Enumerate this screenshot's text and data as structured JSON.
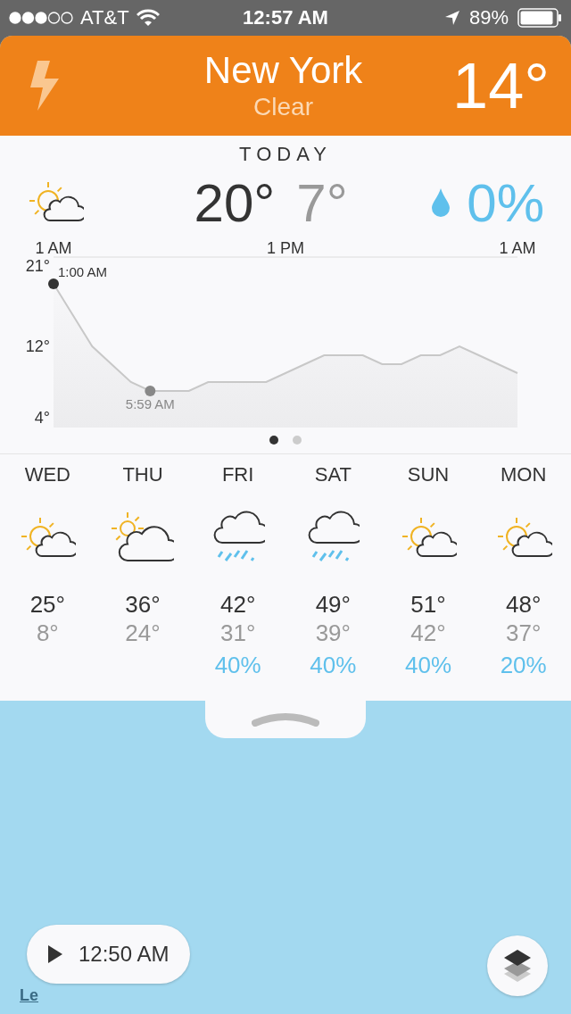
{
  "status_bar": {
    "carrier": "AT&T",
    "time": "12:57 AM",
    "battery": "89%"
  },
  "header": {
    "city": "New York",
    "condition": "Clear",
    "temperature": "14°"
  },
  "today": {
    "title": "TODAY",
    "kind": "partly-sunny",
    "high": "20°",
    "low": "7°",
    "precipitation": "0%",
    "chart_data": {
      "type": "area",
      "categories": [
        "1 AM",
        null,
        null,
        null,
        null,
        null,
        null,
        null,
        null,
        null,
        null,
        null,
        "1 PM",
        null,
        null,
        null,
        null,
        null,
        null,
        null,
        null,
        null,
        null,
        null,
        "1 AM"
      ],
      "series": [
        {
          "color": "#c8c8c8",
          "values": [
            19,
            15.5,
            12,
            10,
            8,
            7,
            7,
            7,
            8,
            8,
            8,
            8,
            9,
            10,
            11,
            11,
            11,
            10,
            10,
            11,
            11,
            12,
            11,
            10,
            9
          ]
        }
      ],
      "yticks": [
        {
          "value": 21,
          "label": "21°"
        },
        {
          "value": 12,
          "label": "12°"
        },
        {
          "value": 4,
          "label": "4°"
        }
      ],
      "ylim": [
        4,
        21
      ],
      "annotations": [
        "1:00 AM",
        "5:59 AM"
      ]
    }
  },
  "pages": [
    {
      "selected": true
    },
    {
      "selected": false
    }
  ],
  "forecast": [
    {
      "day": "WED",
      "kind": "partly-sunny",
      "high": "25°",
      "low": "8°"
    },
    {
      "day": "THU",
      "kind": "mostly-cloudy",
      "high": "36°",
      "low": "24°"
    },
    {
      "day": "FRI",
      "kind": "rain",
      "high": "42°",
      "low": "31°",
      "precipitation": "40%"
    },
    {
      "day": "SAT",
      "kind": "rain",
      "high": "49°",
      "low": "39°",
      "precipitation": "40%"
    },
    {
      "day": "SUN",
      "kind": "partly-sunny",
      "high": "51°",
      "low": "42°",
      "precipitation": "40%"
    },
    {
      "day": "MON",
      "kind": "partly-sunny",
      "high": "48°",
      "low": "37°",
      "precipitation": "20%"
    }
  ],
  "map": {
    "legend_link": "Le",
    "playback_time": "12:50 AM"
  }
}
